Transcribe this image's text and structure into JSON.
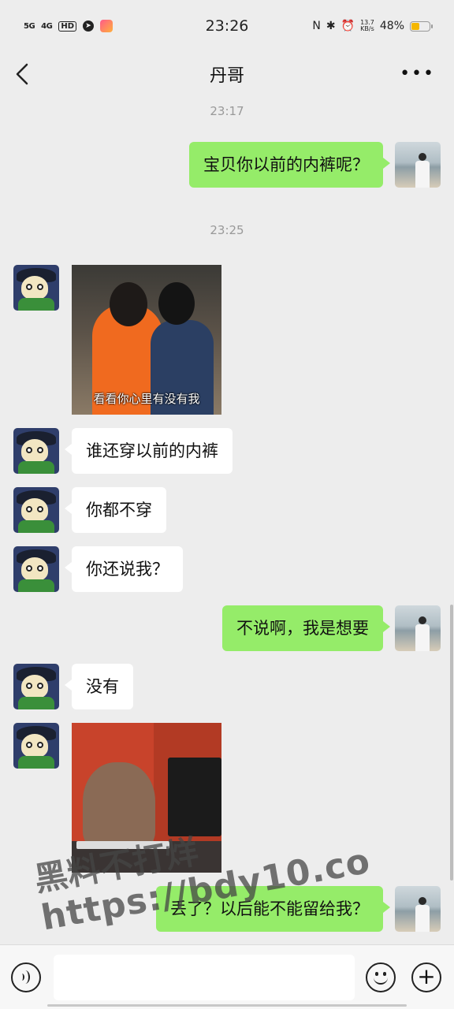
{
  "status_bar": {
    "signal1": "5G",
    "signal2": "4G",
    "hd_badge": "HD",
    "telegram_glyph": "➤",
    "time": "23:26",
    "nfc_glyph": "N",
    "bluetooth_glyph": "✱",
    "alarm_glyph": "⏰",
    "net_speed_value": "13.7",
    "net_speed_unit": "KB/s",
    "battery_percent_text": "48%",
    "battery_level": 0.48,
    "battery_color": "#f5b700"
  },
  "nav": {
    "back_icon": "chevron-left-icon",
    "title": "丹哥",
    "more_glyph": "•••"
  },
  "chat": {
    "timestamps": [
      "23:17",
      "23:25"
    ],
    "messages": [
      {
        "side": "out",
        "type": "text",
        "text": "宝贝你以前的内裤呢？"
      },
      {
        "side": "in",
        "type": "image",
        "caption": "看看你心里有没有我"
      },
      {
        "side": "in",
        "type": "text",
        "text": "谁还穿以前的内裤"
      },
      {
        "side": "in",
        "type": "text",
        "text": "你都不穿"
      },
      {
        "side": "in",
        "type": "text",
        "text": "你还说我？"
      },
      {
        "side": "out",
        "type": "text",
        "text": "不说啊，我是想要"
      },
      {
        "side": "in",
        "type": "text",
        "text": "没有"
      },
      {
        "side": "in",
        "type": "image",
        "caption": ""
      },
      {
        "side": "out",
        "type": "text",
        "text": "丢了？以后能不能留给我？"
      }
    ],
    "bubble_colors": {
      "incoming": "#ffffff",
      "outgoing": "#95ec69"
    }
  },
  "watermark": {
    "line1": "黑料不打烊",
    "line2": "https://bdy10.co"
  },
  "input_bar": {
    "voice_icon": "voice-icon",
    "emoji_icon": "emoji-icon",
    "plus_glyph": "+"
  }
}
